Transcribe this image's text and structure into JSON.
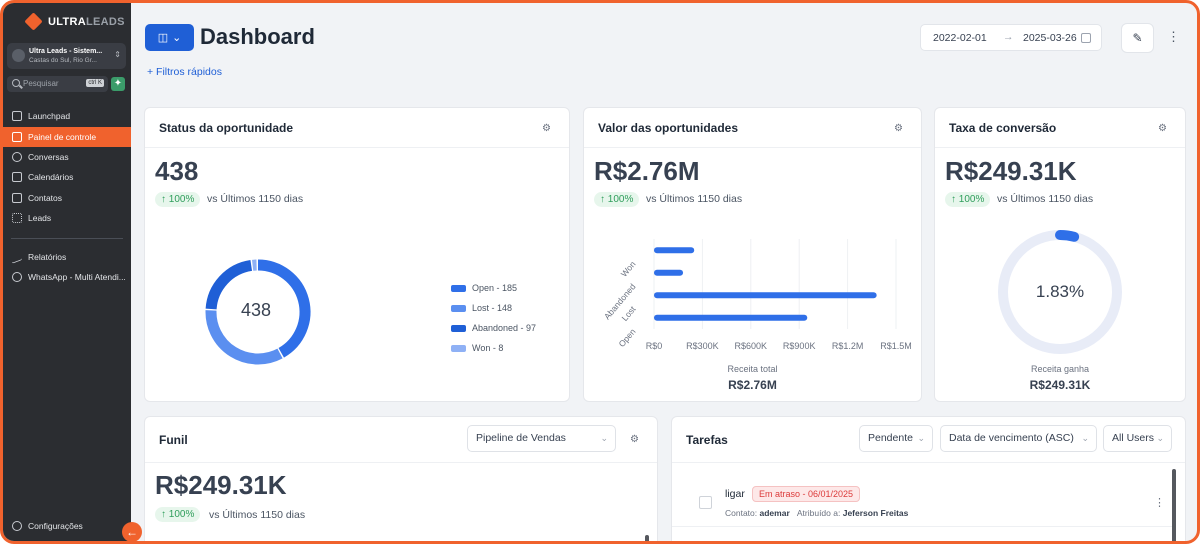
{
  "sidebar": {
    "logo_brand": "ULTRA",
    "logo_brand_rest": "LEADS",
    "account_name": "Ultra Leads - Sistem...",
    "account_location": "Castas do Sul, Rio Gr...",
    "search_placeholder": "Pesquisar",
    "search_shortcut": "ctrl K",
    "items": [
      {
        "label": "Launchpad",
        "icon": "rocket-icon"
      },
      {
        "label": "Painel de controle",
        "icon": "dashboard-icon",
        "active": true
      },
      {
        "label": "Conversas",
        "icon": "chat-icon"
      },
      {
        "label": "Calendários",
        "icon": "calendar-icon"
      },
      {
        "label": "Contatos",
        "icon": "contacts-icon"
      },
      {
        "label": "Leads",
        "icon": "leads-icon"
      },
      {
        "label": "Relatórios",
        "icon": "reports-icon"
      },
      {
        "label": "WhatsApp - Multi Atendi...",
        "icon": "whatsapp-icon"
      }
    ],
    "settings_label": "Configurações",
    "accent_color": "#f0622d"
  },
  "header": {
    "title": "Dashboard",
    "quick_filters": "+ Filtros rápidos",
    "date_start": "2022-02-01",
    "date_end": "2025-03-26"
  },
  "cards": {
    "status": {
      "title": "Status da oportunidade",
      "value": "438",
      "change": "↑ 100%",
      "compare": "vs Últimos 1150 dias",
      "center_label": "438"
    },
    "value": {
      "title": "Valor das oportunidades",
      "value": "R$2.76M",
      "change": "↑ 100%",
      "compare": "vs Últimos 1150 dias",
      "footer_label": "Receita total",
      "footer_value": "R$2.76M"
    },
    "conversion": {
      "title": "Taxa de conversão",
      "value": "R$249.31K",
      "change": "↑ 100%",
      "compare": "vs Últimos 1150 dias",
      "center_label": "1.83%",
      "footer_label": "Receita ganha",
      "footer_value": "R$249.31K"
    },
    "funnel": {
      "title": "Funil",
      "pipeline": "Pipeline de Vendas",
      "value": "R$249.31K",
      "change": "↑ 100%",
      "compare": "vs Últimos 1150 dias"
    },
    "tasks": {
      "title": "Tarefas",
      "filter_status": "Pendente",
      "filter_sort": "Data de vencimento (ASC)",
      "filter_users": "All Users",
      "items": [
        {
          "name": "ligar",
          "badge": "Em atraso - 06/01/2025",
          "contact_label": "Contato:",
          "contact": "ademar",
          "assigned_label": "Atribuído a:",
          "assigned": "Jeferson Freitas"
        }
      ]
    }
  },
  "chart_data": [
    {
      "type": "pie",
      "categories": [
        "Open",
        "Lost",
        "Abandoned",
        "Won"
      ],
      "values": [
        185,
        148,
        97,
        8
      ],
      "legend": [
        "Open - 185",
        "Lost - 148",
        "Abandoned - 97",
        "Won - 8"
      ],
      "colors": [
        "#2f6fe8",
        "#5b8ff0",
        "#1f5fd6",
        "#8fb1f5"
      ]
    },
    {
      "type": "bar",
      "orientation": "horizontal",
      "categories": [
        "Won",
        "Abandoned",
        "Lost",
        "Open"
      ],
      "values": [
        249310,
        180000,
        1380000,
        950000
      ],
      "xticks": [
        "R$0",
        "R$300K",
        "R$600K",
        "R$900K",
        "R$1.2M",
        "R$1.5M"
      ],
      "xlim": [
        0,
        1500000
      ],
      "color": "#2f6fe8"
    },
    {
      "type": "pie",
      "categories": [
        "Conversão"
      ],
      "values": [
        1.83
      ],
      "color": "#2f6fe8",
      "track_color": "#e8ecf7"
    }
  ]
}
